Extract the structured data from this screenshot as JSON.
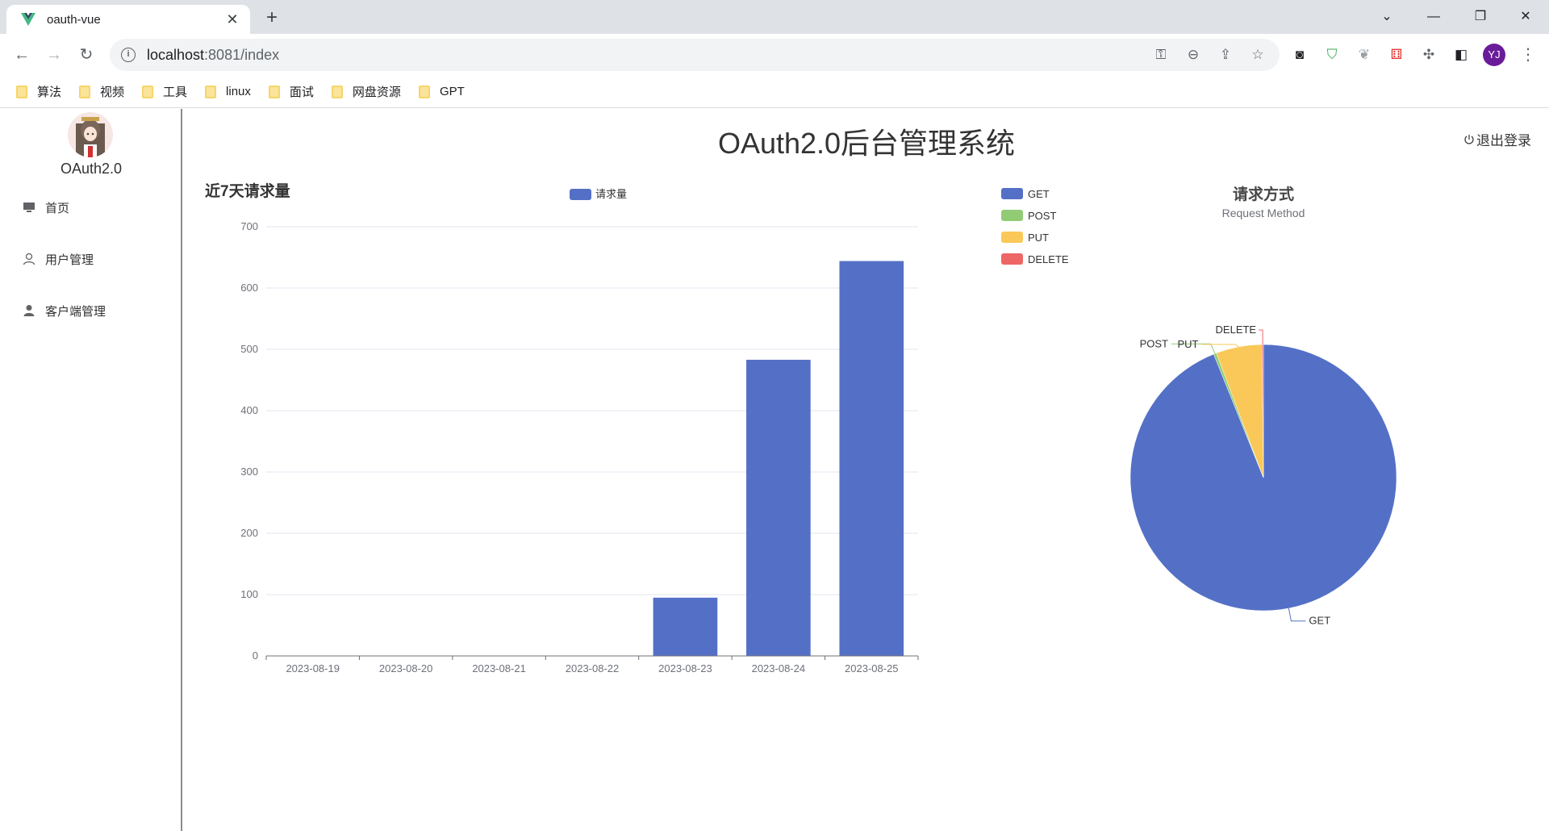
{
  "browser": {
    "tab_title": "oauth-vue",
    "url_host": "localhost",
    "url_rest": ":8081/index",
    "bookmarks": [
      "算法",
      "视频",
      "工具",
      "linux",
      "面试",
      "网盘资源",
      "GPT"
    ],
    "profile_initials": "YJ"
  },
  "app": {
    "name": "OAuth2.0",
    "title": "OAuth2.0后台管理系统",
    "logout_label": "退出登录",
    "menu": [
      {
        "label": "首页",
        "icon": "monitor-icon"
      },
      {
        "label": "用户管理",
        "icon": "user-outline-icon"
      },
      {
        "label": "客户端管理",
        "icon": "user-filled-icon"
      }
    ]
  },
  "chart_data": [
    {
      "type": "bar",
      "title": "近7天请求量",
      "categories": [
        "2023-08-19",
        "2023-08-20",
        "2023-08-21",
        "2023-08-22",
        "2023-08-23",
        "2023-08-24",
        "2023-08-25"
      ],
      "series": [
        {
          "name": "请求量",
          "values": [
            0,
            0,
            0,
            0,
            95,
            483,
            644
          ],
          "color": "#5470c6"
        }
      ],
      "ylim": [
        0,
        700
      ],
      "yticks": [
        0,
        100,
        200,
        300,
        400,
        500,
        600,
        700
      ],
      "grid": true,
      "legend": "top-center"
    },
    {
      "type": "pie",
      "title": "请求方式",
      "subtitle": "Request Method",
      "legend": "top-left",
      "slices": [
        {
          "name": "GET",
          "value": 1110,
          "color": "#5470c6"
        },
        {
          "name": "POST",
          "value": 4,
          "color": "#91cc75"
        },
        {
          "name": "PUT",
          "value": 66,
          "color": "#fac858"
        },
        {
          "name": "DELETE",
          "value": 2,
          "color": "#ee6666"
        }
      ]
    }
  ]
}
